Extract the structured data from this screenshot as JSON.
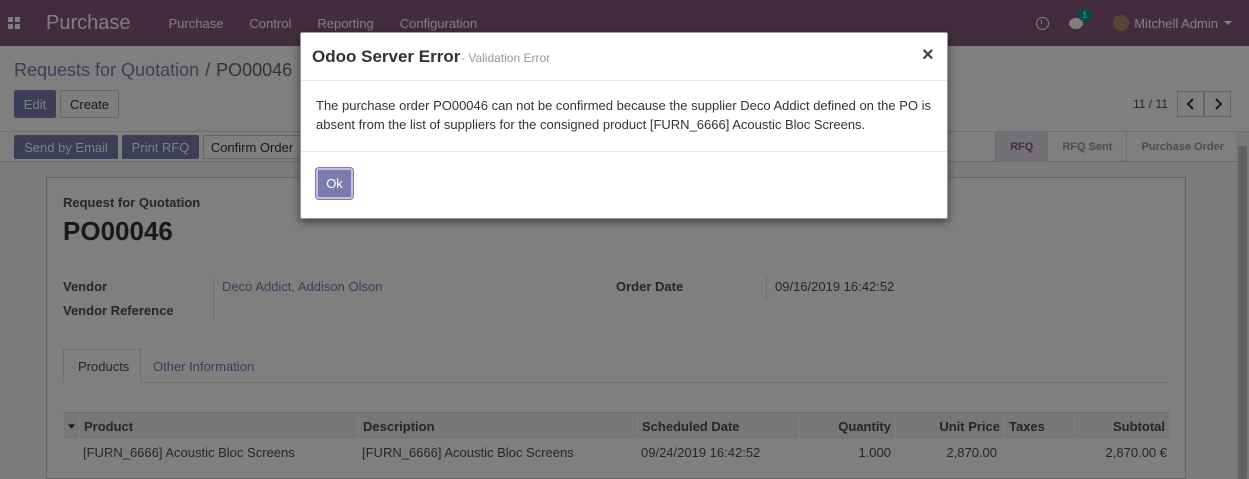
{
  "navbar": {
    "app_title": "Purchase",
    "menu": [
      "Purchase",
      "Control",
      "Reporting",
      "Configuration"
    ],
    "chat_badge": "1",
    "user_name": "Mitchell Admin"
  },
  "breadcrumb": {
    "parent": "Requests for Quotation",
    "separator": "/",
    "current": "PO00046"
  },
  "buttons": {
    "edit": "Edit",
    "create": "Create",
    "send_by_email": "Send by Email",
    "print_rfq": "Print RFQ",
    "confirm_order": "Confirm Order"
  },
  "pager": {
    "value": "11 / 11",
    "prev": "‹",
    "next": "›"
  },
  "statusbar": {
    "steps": [
      "RFQ",
      "RFQ Sent",
      "Purchase Order"
    ],
    "active": "RFQ"
  },
  "form": {
    "doc_type": "Request for Quotation",
    "name": "PO00046",
    "vendor_label": "Vendor",
    "vendor_value": "Deco Addict, Addison Olson",
    "vendor_ref_label": "Vendor Reference",
    "order_date_label": "Order Date",
    "order_date_value": "09/16/2019 16:42:52"
  },
  "tabs": [
    "Products",
    "Other Information"
  ],
  "table": {
    "headers": [
      "Product",
      "Description",
      "Scheduled Date",
      "Quantity",
      "Unit Price",
      "Taxes",
      "Subtotal"
    ],
    "rows": [
      [
        "[FURN_6666] Acoustic Bloc Screens",
        "[FURN_6666] Acoustic Bloc Screens",
        "09/24/2019 16:42:52",
        "1.000",
        "2,870.00",
        "",
        "2,870.00 €"
      ]
    ]
  },
  "modal": {
    "title": "Odoo Server Error",
    "subtitle": "- Validation Error",
    "close": "×",
    "message": "The purchase order PO00046 can not be confirmed because the supplier Deco Addict defined on the PO is absent from the list of suppliers for the consigned product [FURN_6666] Acoustic Bloc Screens.",
    "ok_label": "Ok"
  },
  "colors": {
    "brand": "#875a7b",
    "primary": "#7c7bad"
  }
}
